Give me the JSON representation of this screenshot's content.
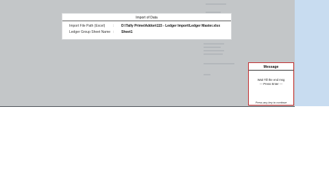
{
  "import_dialog": {
    "title": "Import of Data",
    "fields": [
      {
        "label": "Import File Path (Excel)",
        "separator": ":",
        "value": "D:\\Tally Prime\\Addon\\115 - Ledger Import\\Ledger Master.xlsx"
      },
      {
        "label": "Ledger Group Sheet Name",
        "separator": ":",
        "value": "Sheet1"
      }
    ]
  },
  "message_box": {
    "title": "Message",
    "line1": "Wait Till the end msg",
    "line2": "--- Press Enter ---",
    "footer": "Press any key to continue"
  }
}
